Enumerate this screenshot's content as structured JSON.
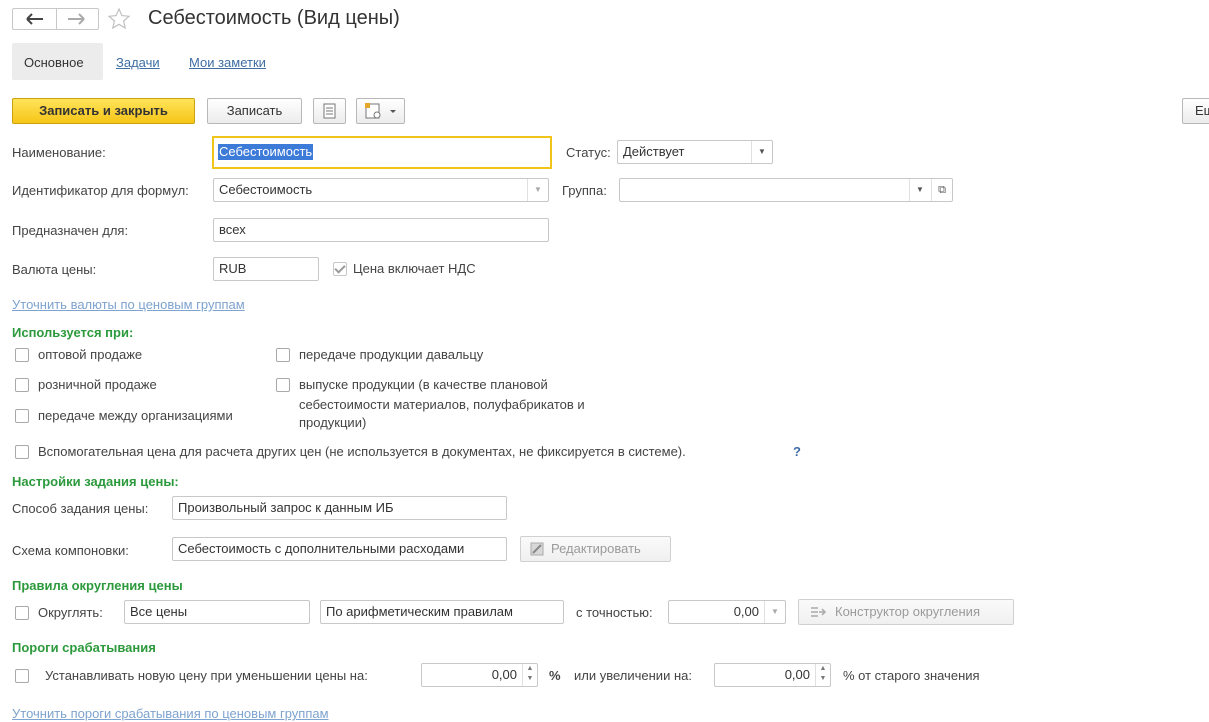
{
  "header": {
    "title": "Себестоимость (Вид цены)"
  },
  "tabs": [
    {
      "label": "Основное",
      "active": true
    },
    {
      "label": "Задачи",
      "active": false
    },
    {
      "label": "Мои заметки",
      "active": false
    }
  ],
  "toolbar": {
    "save_close_label": "Записать и закрыть",
    "save_label": "Записать",
    "more_label": "Ещё"
  },
  "form": {
    "name_label": "Наименование:",
    "name_value": "Себестоимость",
    "status_label": "Статус:",
    "status_value": "Действует",
    "formula_id_label": "Идентификатор для формул:",
    "formula_id_value": "Себестоимость",
    "group_label": "Группа:",
    "group_value": "",
    "intended_label": "Предназначен для:",
    "intended_value": "всех",
    "currency_label": "Валюта цены:",
    "currency_value": "RUB",
    "vat_label": "Цена включает НДС",
    "vat_checked": true,
    "refine_currency_link": "Уточнить валюты по ценовым группам"
  },
  "used_in": {
    "heading": "Используется при:",
    "options": [
      {
        "label": "оптовой продаже",
        "checked": false
      },
      {
        "label": "розничной продаже",
        "checked": false
      },
      {
        "label": "передаче между организациями",
        "checked": false
      },
      {
        "label": "передаче продукции давальцу",
        "checked": false
      },
      {
        "label": "выпуске продукции (в качестве плановой",
        "checked": false
      },
      {
        "label": "себестоимости материалов, полуфабрикатов и",
        "checked": false
      },
      {
        "label": "продукции)",
        "checked": false
      }
    ],
    "aux_label": "Вспомогательная цена для расчета других цен (не используется в документах, не фиксируется в системе).",
    "aux_help": "?"
  },
  "price_settings": {
    "heading": "Настройки задания цены:",
    "method_label": "Способ задания цены:",
    "method_value": "Произвольный запрос к данным ИБ",
    "scheme_label": "Схема компоновки:",
    "scheme_value": "Себестоимость с дополнительными расходами",
    "edit_label": "Редактировать"
  },
  "rounding": {
    "heading": "Правила округления цены",
    "round_label": "Округлять:",
    "scope_value": "Все цены",
    "rule_value": "По арифметическим правилам",
    "precision_label": "с точностью:",
    "precision_value": "0,00",
    "constructor_label": "Конструктор округления"
  },
  "thresholds": {
    "heading": "Пороги срабатывания",
    "set_label": "Устанавливать новую цену при уменьшении цены на:",
    "decrease_value": "0,00",
    "percent1": "%",
    "increase_label": "или увеличении на:",
    "increase_value": "0,00",
    "percent2": "% от старого значения",
    "refine_link": "Уточнить пороги срабатывания по ценовым группам"
  },
  "colors": {
    "accent_yellow": "#f6c517",
    "section_green": "#2c9a3c",
    "link_blue": "#3f6ea5"
  }
}
